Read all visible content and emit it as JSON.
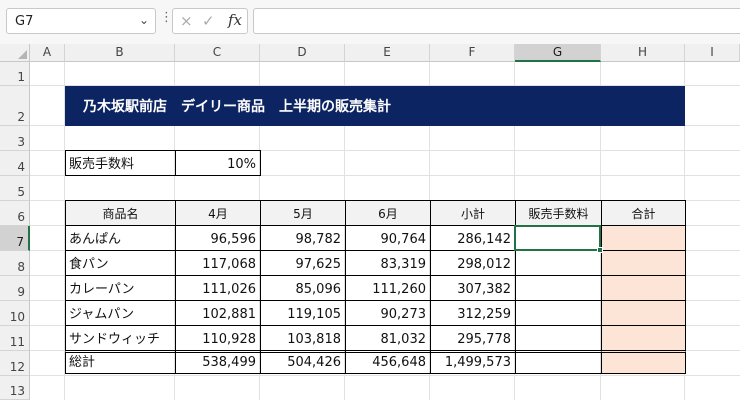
{
  "formula_bar": {
    "name_box": "G7",
    "fx_label": "fx",
    "cancel_icon": "×",
    "confirm_icon": "✓",
    "formula": ""
  },
  "columns": [
    "A",
    "B",
    "C",
    "D",
    "E",
    "F",
    "G",
    "H",
    "I"
  ],
  "rows": [
    "1",
    "2",
    "3",
    "4",
    "5",
    "6",
    "7",
    "8",
    "9",
    "10",
    "11",
    "12",
    "13"
  ],
  "selected_cell": "G7",
  "title": "乃木坂駅前店　デイリー商品　上半期の販売集計",
  "commission": {
    "label": "販売手数料",
    "value": "10%"
  },
  "table": {
    "headers": [
      "商品名",
      "4月",
      "5月",
      "6月",
      "小計",
      "販売手数料",
      "合計"
    ],
    "rows": [
      [
        "あんぱん",
        "96,596",
        "98,782",
        "90,764",
        "286,142",
        "",
        ""
      ],
      [
        "食パン",
        "117,068",
        "97,625",
        "83,319",
        "298,012",
        "",
        ""
      ],
      [
        "カレーパン",
        "111,026",
        "85,096",
        "111,260",
        "307,382",
        "",
        ""
      ],
      [
        "ジャムパン",
        "102,881",
        "119,105",
        "90,273",
        "312,259",
        "",
        ""
      ],
      [
        "サンドウィッチ",
        "110,928",
        "103,818",
        "81,032",
        "295,778",
        "",
        ""
      ]
    ],
    "total": [
      "総計",
      "538,499",
      "504,426",
      "456,648",
      "1,499,573",
      "",
      ""
    ]
  },
  "colors": {
    "banner": "#0c2461",
    "total_fill": "#fce4d6",
    "selection": "#217346"
  }
}
